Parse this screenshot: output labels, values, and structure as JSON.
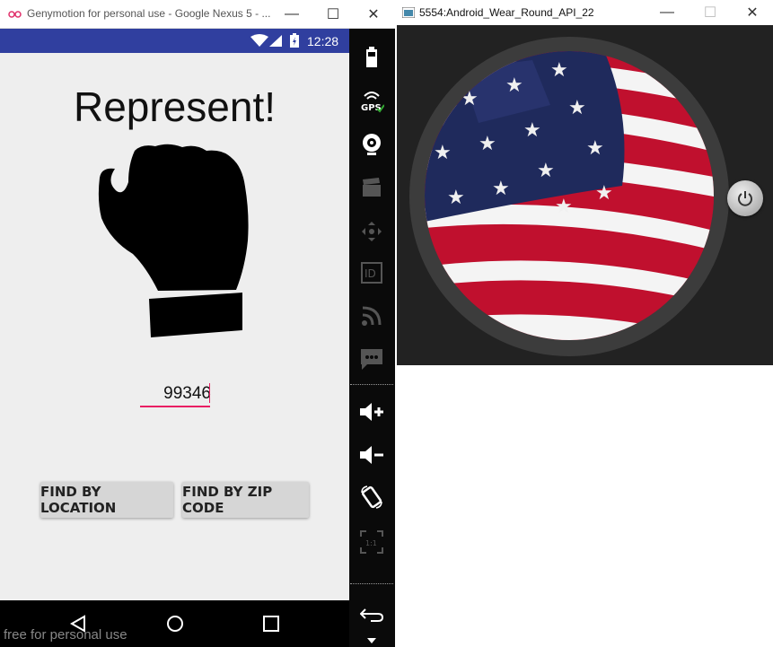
{
  "genymotion": {
    "window_title": "Genymotion for personal use - Google Nexus 5 - ...",
    "status_time": "12:28",
    "watermark": "free for personal use"
  },
  "app": {
    "title": "Represent!",
    "zip_value": "99346",
    "find_by_location": "FIND BY LOCATION",
    "find_by_zip": "FIND BY ZIP CODE"
  },
  "toolbar": {
    "gps_label": "GPS",
    "id_label": "ID",
    "pixel_label": "1:1"
  },
  "wear": {
    "window_title": "5554:Android_Wear_Round_API_22"
  },
  "colors": {
    "status_bar": "#303f9f",
    "accent": "#e91e63",
    "screen_bg": "#eeeeee",
    "button_bg": "#d6d6d6"
  }
}
